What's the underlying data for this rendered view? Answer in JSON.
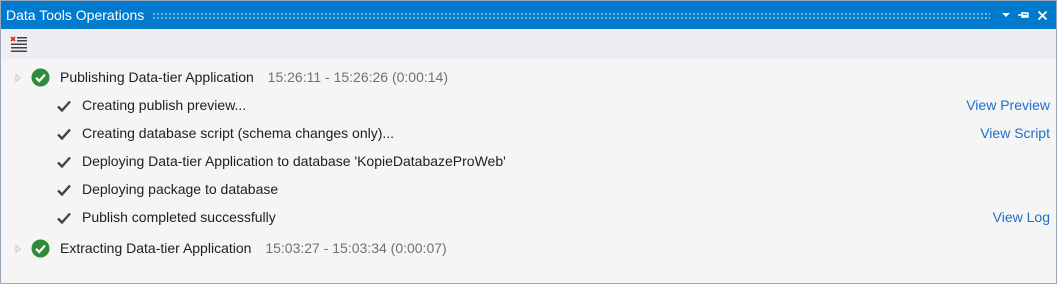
{
  "window": {
    "title": "Data Tools Operations",
    "buttons": {
      "dropdown_icon": "chevron-down-icon",
      "pin_icon": "pin-icon",
      "close_icon": "close-icon"
    },
    "colors": {
      "titlebar": "#007acc",
      "link": "#1e6fc8",
      "success": "#2e8b3a"
    }
  },
  "toolbar": {
    "clear_icon": "clear-all-icon"
  },
  "operations": [
    {
      "title": "Publishing Data-tier Application",
      "time": "15:26:11 - 15:26:26 (0:00:14)",
      "status": "success",
      "steps": [
        {
          "text": "Creating publish preview...",
          "link": "View Preview"
        },
        {
          "text": "Creating database script (schema changes only)...",
          "link": "View Script"
        },
        {
          "text": "Deploying Data-tier Application to database 'KopieDatabazeProWeb'",
          "link": ""
        },
        {
          "text": "Deploying package to database",
          "link": ""
        },
        {
          "text": "Publish completed successfully",
          "link": "View Log"
        }
      ]
    },
    {
      "title": "Extracting Data-tier Application",
      "time": "15:03:27 - 15:03:34 (0:00:07)",
      "status": "success",
      "steps": []
    }
  ]
}
